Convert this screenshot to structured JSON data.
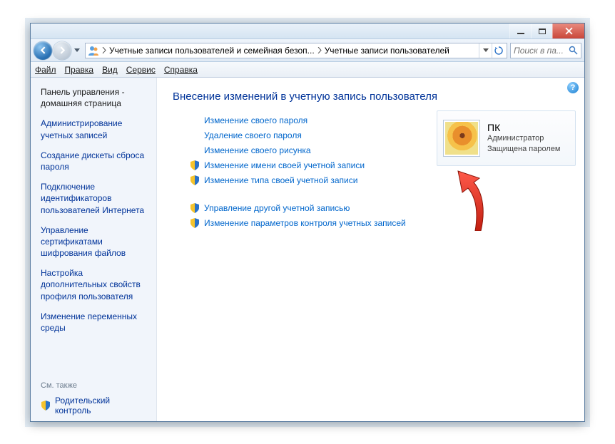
{
  "titlebar": {},
  "address": {
    "crumb1": "Учетные записи пользователей и семейная безоп...",
    "crumb2": "Учетные записи пользователей"
  },
  "search": {
    "placeholder": "Поиск в па..."
  },
  "menu": {
    "file": "Файл",
    "edit": "Правка",
    "view": "Вид",
    "tools": "Сервис",
    "help": "Справка"
  },
  "sidebar": {
    "home": "Панель управления - домашняя страница",
    "items": [
      "Администрирование учетных записей",
      "Создание дискеты сброса пароля",
      "Подключение идентификаторов пользователей Интернета",
      "Управление сертификатами шифрования файлов",
      "Настройка дополнительных свойств профиля пользователя",
      "Изменение переменных среды"
    ],
    "seealso": "См. также",
    "parental": "Родительский контроль"
  },
  "main": {
    "title": "Внесение изменений в учетную запись пользователя",
    "links1": [
      {
        "shield": false,
        "text": "Изменение своего пароля"
      },
      {
        "shield": false,
        "text": "Удаление своего пароля"
      },
      {
        "shield": false,
        "text": "Изменение своего рисунка"
      },
      {
        "shield": true,
        "text": "Изменение имени своей учетной записи"
      },
      {
        "shield": true,
        "text": "Изменение типа своей учетной записи"
      }
    ],
    "links2": [
      {
        "shield": true,
        "text": "Управление другой учетной записью"
      },
      {
        "shield": true,
        "text": "Изменение параметров контроля учетных записей"
      }
    ]
  },
  "user": {
    "name": "ПК",
    "role": "Администратор",
    "protected": "Защищена паролем"
  }
}
